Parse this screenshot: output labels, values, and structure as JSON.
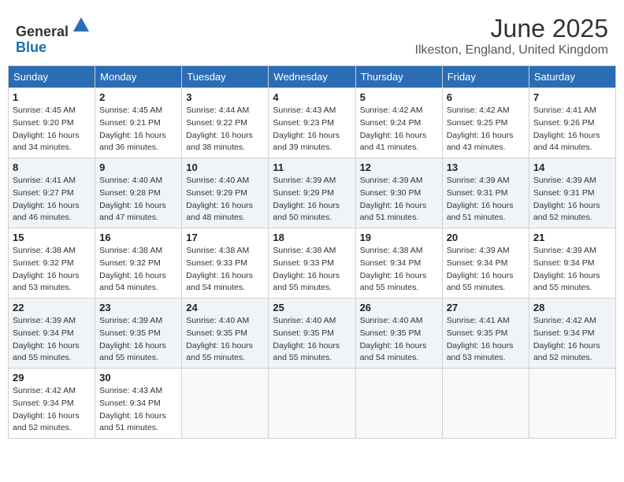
{
  "header": {
    "logo_line1": "General",
    "logo_line2": "Blue",
    "month": "June 2025",
    "location": "Ilkeston, England, United Kingdom"
  },
  "weekdays": [
    "Sunday",
    "Monday",
    "Tuesday",
    "Wednesday",
    "Thursday",
    "Friday",
    "Saturday"
  ],
  "weeks": [
    [
      {
        "day": "1",
        "sunrise": "4:45 AM",
        "sunset": "9:20 PM",
        "daylight": "16 hours and 34 minutes."
      },
      {
        "day": "2",
        "sunrise": "4:45 AM",
        "sunset": "9:21 PM",
        "daylight": "16 hours and 36 minutes."
      },
      {
        "day": "3",
        "sunrise": "4:44 AM",
        "sunset": "9:22 PM",
        "daylight": "16 hours and 38 minutes."
      },
      {
        "day": "4",
        "sunrise": "4:43 AM",
        "sunset": "9:23 PM",
        "daylight": "16 hours and 39 minutes."
      },
      {
        "day": "5",
        "sunrise": "4:42 AM",
        "sunset": "9:24 PM",
        "daylight": "16 hours and 41 minutes."
      },
      {
        "day": "6",
        "sunrise": "4:42 AM",
        "sunset": "9:25 PM",
        "daylight": "16 hours and 43 minutes."
      },
      {
        "day": "7",
        "sunrise": "4:41 AM",
        "sunset": "9:26 PM",
        "daylight": "16 hours and 44 minutes."
      }
    ],
    [
      {
        "day": "8",
        "sunrise": "4:41 AM",
        "sunset": "9:27 PM",
        "daylight": "16 hours and 46 minutes."
      },
      {
        "day": "9",
        "sunrise": "4:40 AM",
        "sunset": "9:28 PM",
        "daylight": "16 hours and 47 minutes."
      },
      {
        "day": "10",
        "sunrise": "4:40 AM",
        "sunset": "9:29 PM",
        "daylight": "16 hours and 48 minutes."
      },
      {
        "day": "11",
        "sunrise": "4:39 AM",
        "sunset": "9:29 PM",
        "daylight": "16 hours and 50 minutes."
      },
      {
        "day": "12",
        "sunrise": "4:39 AM",
        "sunset": "9:30 PM",
        "daylight": "16 hours and 51 minutes."
      },
      {
        "day": "13",
        "sunrise": "4:39 AM",
        "sunset": "9:31 PM",
        "daylight": "16 hours and 51 minutes."
      },
      {
        "day": "14",
        "sunrise": "4:39 AM",
        "sunset": "9:31 PM",
        "daylight": "16 hours and 52 minutes."
      }
    ],
    [
      {
        "day": "15",
        "sunrise": "4:38 AM",
        "sunset": "9:32 PM",
        "daylight": "16 hours and 53 minutes."
      },
      {
        "day": "16",
        "sunrise": "4:38 AM",
        "sunset": "9:32 PM",
        "daylight": "16 hours and 54 minutes."
      },
      {
        "day": "17",
        "sunrise": "4:38 AM",
        "sunset": "9:33 PM",
        "daylight": "16 hours and 54 minutes."
      },
      {
        "day": "18",
        "sunrise": "4:38 AM",
        "sunset": "9:33 PM",
        "daylight": "16 hours and 55 minutes."
      },
      {
        "day": "19",
        "sunrise": "4:38 AM",
        "sunset": "9:34 PM",
        "daylight": "16 hours and 55 minutes."
      },
      {
        "day": "20",
        "sunrise": "4:39 AM",
        "sunset": "9:34 PM",
        "daylight": "16 hours and 55 minutes."
      },
      {
        "day": "21",
        "sunrise": "4:39 AM",
        "sunset": "9:34 PM",
        "daylight": "16 hours and 55 minutes."
      }
    ],
    [
      {
        "day": "22",
        "sunrise": "4:39 AM",
        "sunset": "9:34 PM",
        "daylight": "16 hours and 55 minutes."
      },
      {
        "day": "23",
        "sunrise": "4:39 AM",
        "sunset": "9:35 PM",
        "daylight": "16 hours and 55 minutes."
      },
      {
        "day": "24",
        "sunrise": "4:40 AM",
        "sunset": "9:35 PM",
        "daylight": "16 hours and 55 minutes."
      },
      {
        "day": "25",
        "sunrise": "4:40 AM",
        "sunset": "9:35 PM",
        "daylight": "16 hours and 55 minutes."
      },
      {
        "day": "26",
        "sunrise": "4:40 AM",
        "sunset": "9:35 PM",
        "daylight": "16 hours and 54 minutes."
      },
      {
        "day": "27",
        "sunrise": "4:41 AM",
        "sunset": "9:35 PM",
        "daylight": "16 hours and 53 minutes."
      },
      {
        "day": "28",
        "sunrise": "4:42 AM",
        "sunset": "9:34 PM",
        "daylight": "16 hours and 52 minutes."
      }
    ],
    [
      {
        "day": "29",
        "sunrise": "4:42 AM",
        "sunset": "9:34 PM",
        "daylight": "16 hours and 52 minutes."
      },
      {
        "day": "30",
        "sunrise": "4:43 AM",
        "sunset": "9:34 PM",
        "daylight": "16 hours and 51 minutes."
      },
      null,
      null,
      null,
      null,
      null
    ]
  ]
}
